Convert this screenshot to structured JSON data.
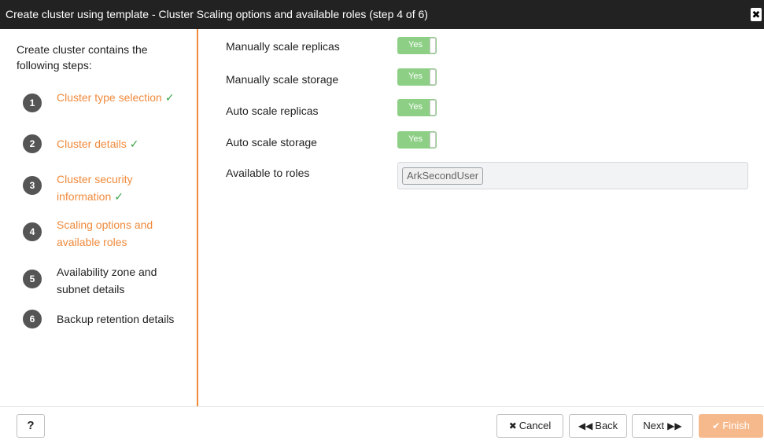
{
  "dialog": {
    "title": "Create cluster using template - Cluster Scaling options and available roles (step 4 of 6)",
    "close_glyph": "✖"
  },
  "sidebar": {
    "intro": "Create cluster contains the following steps:",
    "check_glyph": "✓",
    "steps": [
      {
        "num": "1",
        "label": "Cluster type selection",
        "status": "done"
      },
      {
        "num": "2",
        "label": "Cluster details",
        "status": "done"
      },
      {
        "num": "3",
        "label": "Cluster security information",
        "status": "done"
      },
      {
        "num": "4",
        "label": "Scaling options and available roles",
        "status": "current"
      },
      {
        "num": "5",
        "label": "Availability zone and subnet details",
        "status": "todo"
      },
      {
        "num": "6",
        "label": "Backup retention details",
        "status": "todo"
      }
    ]
  },
  "form": {
    "fields": [
      {
        "label": "Manually scale replicas",
        "value": "Yes"
      },
      {
        "label": "Manually scale storage",
        "value": "Yes"
      },
      {
        "label": "Auto scale replicas",
        "value": "Yes"
      },
      {
        "label": "Auto scale storage",
        "value": "Yes"
      }
    ],
    "roles": {
      "label": "Available to roles",
      "selected": [
        "ArkSecondUser"
      ]
    }
  },
  "footer": {
    "help_label": "?",
    "cancel_label": "Cancel",
    "back_label": "Back",
    "next_label": "Next",
    "finish_label": "Finish",
    "icons": {
      "cancel": "✖",
      "back": "◀◀",
      "next": "▶▶",
      "finish": "✔"
    }
  },
  "colors": {
    "accent": "#f08a3c",
    "titlebar": "#222222",
    "toggle_on": "#8ccf85",
    "check": "#3aa345",
    "finish_disabled": "#f6b98c"
  }
}
